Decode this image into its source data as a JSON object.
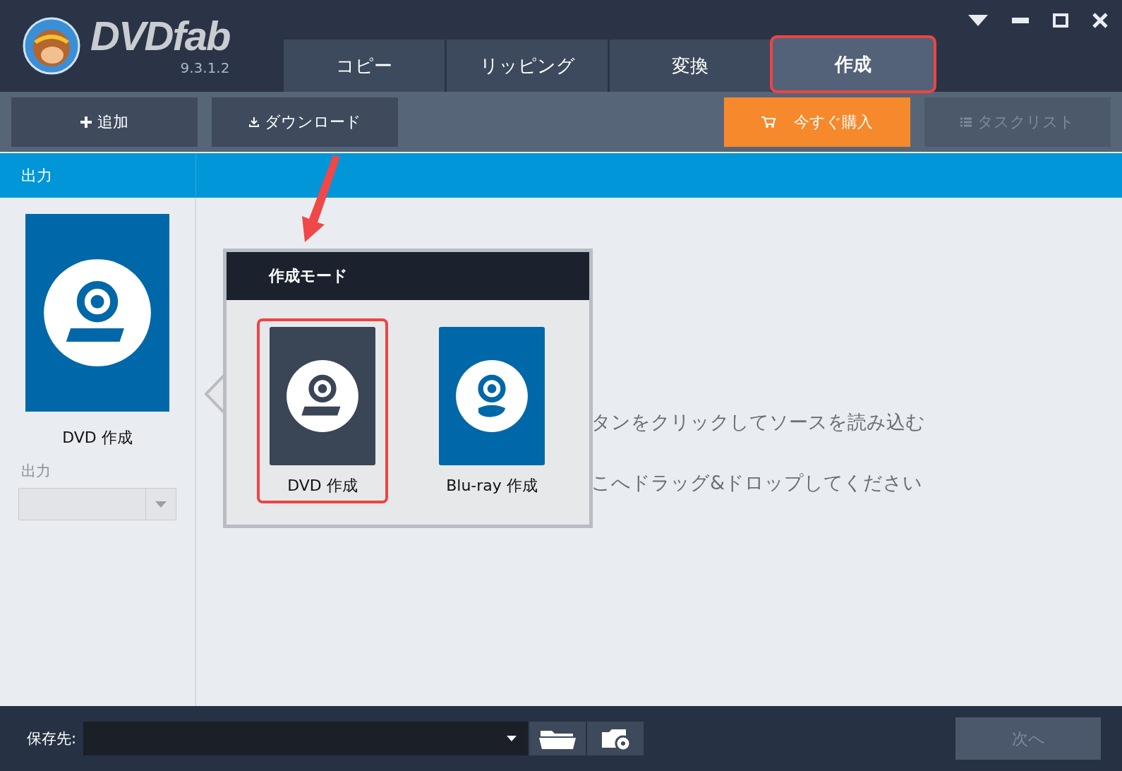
{
  "app": {
    "logo": "DVDfab",
    "version": "9.3.1.2"
  },
  "tabs": [
    {
      "label": "コピー",
      "selected": false
    },
    {
      "label": "リッピング",
      "selected": false
    },
    {
      "label": "変換",
      "selected": false
    },
    {
      "label": "作成",
      "selected": true
    }
  ],
  "toolbar": {
    "add": "追加",
    "download": "ダウンロード",
    "buy": "今すぐ購入",
    "task_list": {
      "label": "タスクリスト",
      "disabled": true
    }
  },
  "sidebar": {
    "header": "出力",
    "mode_label": "DVD 作成",
    "output_label": "出力"
  },
  "hint_lines": [
    "タンをクリックしてソースを読み込む",
    "こへドラッグ&ドロップしてください"
  ],
  "popup": {
    "title": "作成モード",
    "modes": [
      {
        "label": "DVD 作成",
        "kind": "dvd",
        "selected": true
      },
      {
        "label": "Blu-ray 作成",
        "kind": "bluray",
        "selected": false
      }
    ]
  },
  "footer": {
    "save_label": "保存先:",
    "next": {
      "label": "次へ",
      "disabled": true
    }
  }
}
